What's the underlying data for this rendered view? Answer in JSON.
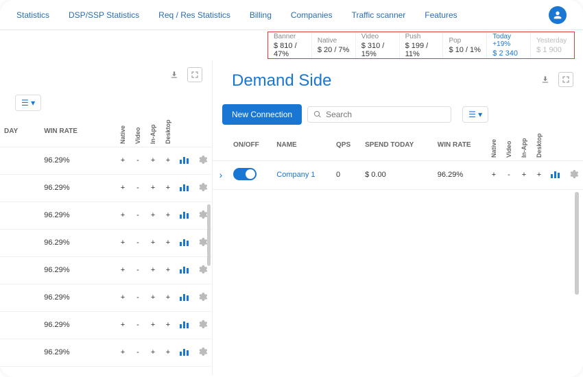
{
  "nav": [
    "Statistics",
    "DSP/SSP Statistics",
    "Req / Res Statistics",
    "Billing",
    "Companies",
    "Traffic scanner",
    "Features"
  ],
  "stats": [
    {
      "label": "Banner",
      "value": "$ 810 / 47%"
    },
    {
      "label": "Native",
      "value": "$ 20 / 7%"
    },
    {
      "label": "Video",
      "value": "$ 310 / 15%"
    },
    {
      "label": "Push",
      "value": "$ 199 / 11%"
    },
    {
      "label": "Pop",
      "value": "$ 10 / 1%"
    },
    {
      "label": "Today +19%",
      "value": "$ 2 340",
      "cls": "today"
    },
    {
      "label": "Yesterday",
      "value": "$ 1 900",
      "cls": "yest"
    }
  ],
  "left": {
    "headers": {
      "day": "DAY",
      "winrate": "WIN RATE",
      "native": "Native",
      "video": "Video",
      "inapp": "In-App",
      "desktop": "Desktop"
    },
    "rows": [
      {
        "winrate": "96.29%",
        "native": "+",
        "video": "-",
        "inapp": "+",
        "desktop": "+"
      },
      {
        "winrate": "96.29%",
        "native": "+",
        "video": "-",
        "inapp": "+",
        "desktop": "+"
      },
      {
        "winrate": "96.29%",
        "native": "+",
        "video": "-",
        "inapp": "+",
        "desktop": "+"
      },
      {
        "winrate": "96.29%",
        "native": "+",
        "video": "-",
        "inapp": "+",
        "desktop": "+"
      },
      {
        "winrate": "96.29%",
        "native": "+",
        "video": "-",
        "inapp": "+",
        "desktop": "+"
      },
      {
        "winrate": "96.29%",
        "native": "+",
        "video": "-",
        "inapp": "+",
        "desktop": "+"
      },
      {
        "winrate": "96.29%",
        "native": "+",
        "video": "-",
        "inapp": "+",
        "desktop": "+"
      },
      {
        "winrate": "96.29%",
        "native": "+",
        "video": "-",
        "inapp": "+",
        "desktop": "+"
      }
    ]
  },
  "right": {
    "title": "Demand Side",
    "newconn": "New Connection",
    "search_ph": "Search",
    "headers": {
      "onoff": "ON/OFF",
      "name": "NAME",
      "qps": "QPS",
      "spend": "SPEND TODAY",
      "winrate": "WIN RATE",
      "native": "Native",
      "video": "Video",
      "inapp": "In-App",
      "desktop": "Desktop"
    },
    "rows": [
      {
        "name": "Company 1",
        "qps": "0",
        "spend": "$ 0.00",
        "winrate": "96.29%",
        "native": "+",
        "video": "-",
        "inapp": "+",
        "desktop": "+"
      }
    ]
  }
}
